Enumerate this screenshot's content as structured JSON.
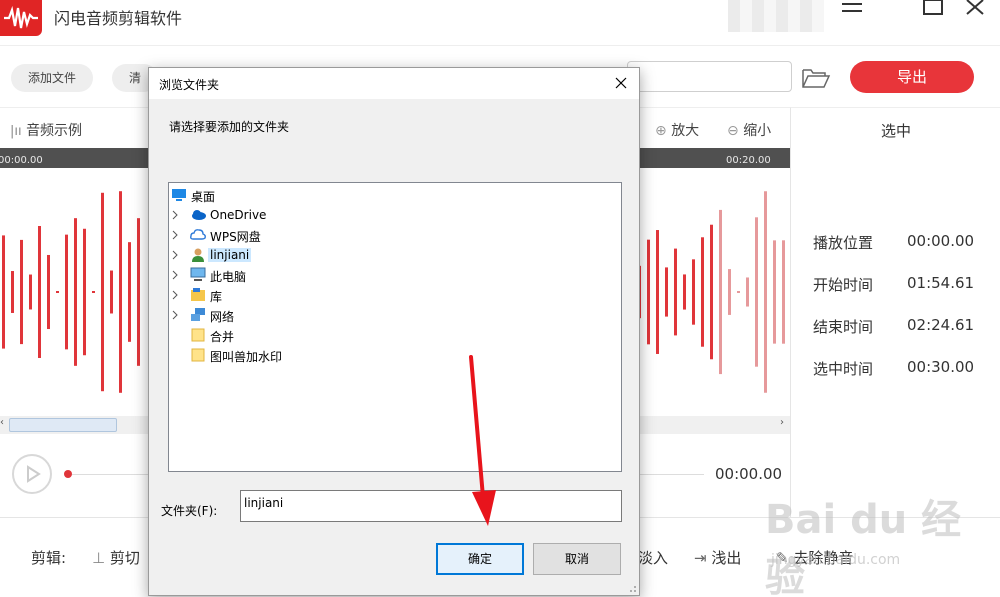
{
  "app": {
    "title": "闪电音频剪辑软件",
    "logo_icon": "waveform-logo-icon",
    "accent_color": "#e8353a"
  },
  "window_controls": {
    "menu_icon": "hamburger-icon",
    "maximize_icon": "maximize-icon",
    "close_icon": "close-icon"
  },
  "toolbar": {
    "add_file_label": "添加文件",
    "clear_label": "清",
    "path_value": "",
    "folder_icon": "folder-open-icon",
    "export_label": "导出"
  },
  "subbar": {
    "sample_label": "音频示例",
    "zoom_in_label": "放大",
    "zoom_out_label": "缩小"
  },
  "timeline": {
    "start_label": "00:00.00",
    "end_label": "00:20.00"
  },
  "panel": {
    "title": "选中",
    "rows": [
      {
        "label": "播放位置",
        "value": "00:00.00"
      },
      {
        "label": "开始时间",
        "value": "01:54.61"
      },
      {
        "label": "结束时间",
        "value": "02:24.61"
      },
      {
        "label": "选中时间",
        "value": "00:30.00"
      }
    ]
  },
  "player": {
    "time": "00:00.00",
    "play_icon": "play-icon"
  },
  "bottom": {
    "edit_label": "剪辑:",
    "cut_label": "剪切",
    "fade_in_label": "淡入",
    "fade_out_label": "浅出",
    "remove_silence_label": "去除静音"
  },
  "watermark": {
    "main": "Bai du 经验",
    "sub": "jingyan.baidu.com"
  },
  "dialog": {
    "title": "浏览文件夹",
    "prompt": "请选择要添加的文件夹",
    "tree": [
      {
        "label": "桌面",
        "icon": "desktop-icon",
        "expandable": false
      },
      {
        "label": "OneDrive",
        "icon": "onedrive-cloud-icon",
        "expandable": true
      },
      {
        "label": "WPS网盘",
        "icon": "wps-cloud-icon",
        "expandable": true
      },
      {
        "label": "linjiani",
        "icon": "user-icon",
        "expandable": true,
        "selected": true
      },
      {
        "label": "此电脑",
        "icon": "computer-icon",
        "expandable": true
      },
      {
        "label": "库",
        "icon": "library-icon",
        "expandable": true
      },
      {
        "label": "网络",
        "icon": "network-icon",
        "expandable": true
      },
      {
        "label": "合并",
        "icon": "folder-icon",
        "expandable": false
      },
      {
        "label": "图叫兽加水印",
        "icon": "folder-icon",
        "expandable": false
      }
    ],
    "folder_field_label": "文件夹(F):",
    "folder_field_value": "linjiani",
    "ok_label": "确定",
    "cancel_label": "取消"
  }
}
